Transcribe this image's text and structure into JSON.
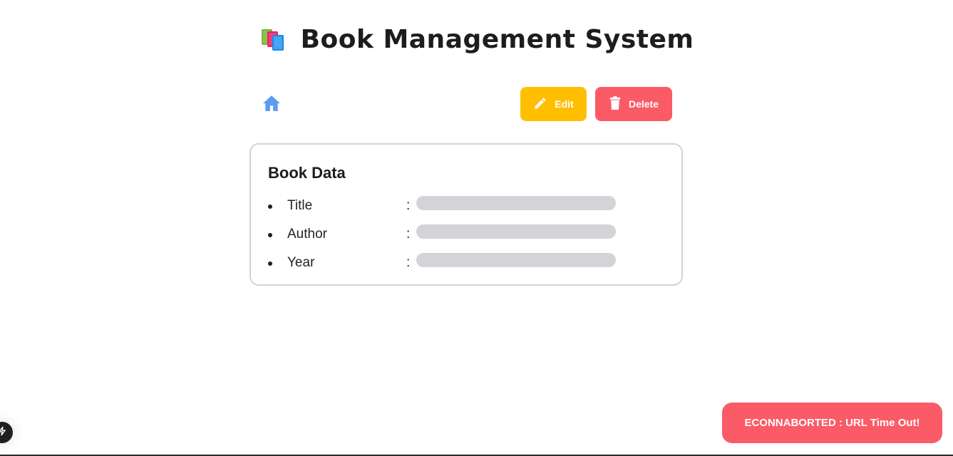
{
  "header": {
    "title": "Book Management System",
    "icon": "books-icon"
  },
  "toolbar": {
    "home_icon": "home-icon",
    "edit_label": "Edit",
    "delete_label": "Delete"
  },
  "card": {
    "title": "Book Data",
    "fields": [
      {
        "label": "Title",
        "separator": ":",
        "value_state": "loading"
      },
      {
        "label": "Author",
        "separator": ":",
        "value_state": "loading"
      },
      {
        "label": "Year",
        "separator": ":",
        "value_state": "loading"
      }
    ]
  },
  "toast": {
    "message": "ECONNABORTED : URL Time Out!"
  },
  "colors": {
    "edit": "#ffbf00",
    "delete": "#fb5a67",
    "home_icon": "#5a9cf0",
    "skeleton": "#d4d4d8"
  }
}
